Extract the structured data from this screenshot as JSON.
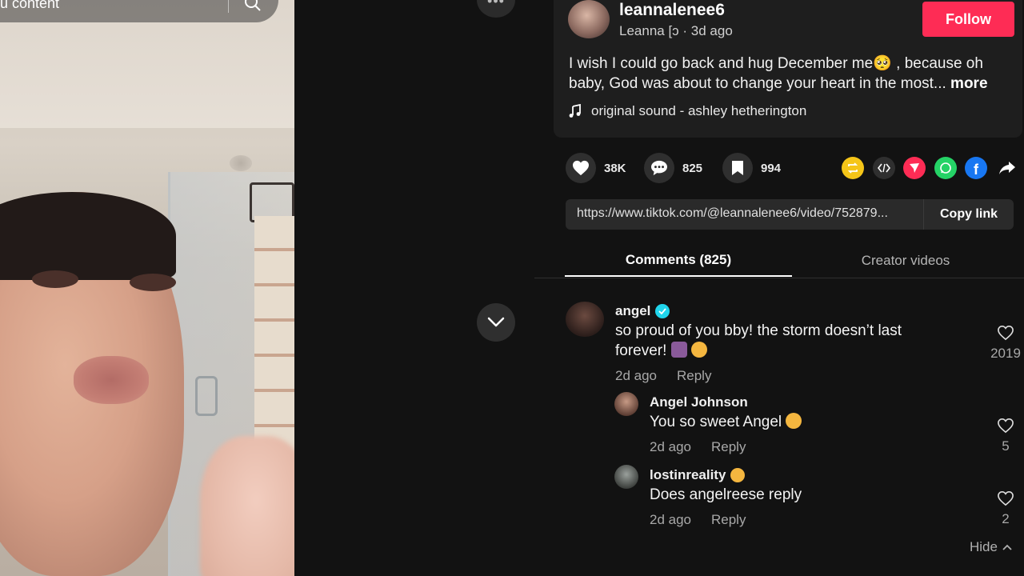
{
  "video": {
    "search_text": "u content",
    "search_icon": "search-icon"
  },
  "nav": {
    "more_icon": "ellipsis-icon",
    "down_icon": "chevron-down-icon"
  },
  "author": {
    "username": "leannalenee6",
    "display_name_time": "Leanna [ɔ · 3d ago",
    "follow_label": "Follow"
  },
  "caption": {
    "text": "I wish I could go back and hug December me🥺 , because oh baby, God was about to change your heart in the most...",
    "more_label": "more"
  },
  "sound": {
    "label": "original sound - ashley hetherington"
  },
  "actions": {
    "likes": "38K",
    "comments": "825",
    "saves": "994"
  },
  "share_icons": [
    "repost-icon",
    "embed-icon",
    "send-icon",
    "whatsapp-icon",
    "facebook-icon",
    "share-arrow-icon"
  ],
  "link": {
    "url": "https://www.tiktok.com/@leannalenee6/video/752879...",
    "copy_label": "Copy link"
  },
  "tabs": {
    "comments": "Comments (825)",
    "creator_videos": "Creator videos"
  },
  "comments": [
    {
      "name": "angel",
      "line1": "so proud of you bby! the storm doesn’t last",
      "line2": "forever!",
      "time": "2d ago",
      "reply": "Reply",
      "likes": "2019"
    },
    {
      "name": "Angel Johnson",
      "text": "You so sweet Angel",
      "time": "2d ago",
      "reply": "Reply",
      "likes": "5"
    },
    {
      "name": "lostinreality",
      "text": "Does angelreese reply",
      "time": "2d ago",
      "reply": "Reply",
      "likes": "2"
    }
  ],
  "hide_label": "Hide",
  "colors": {
    "follow": "#fe2c55",
    "background": "#121212",
    "card": "#1e1e1e"
  }
}
